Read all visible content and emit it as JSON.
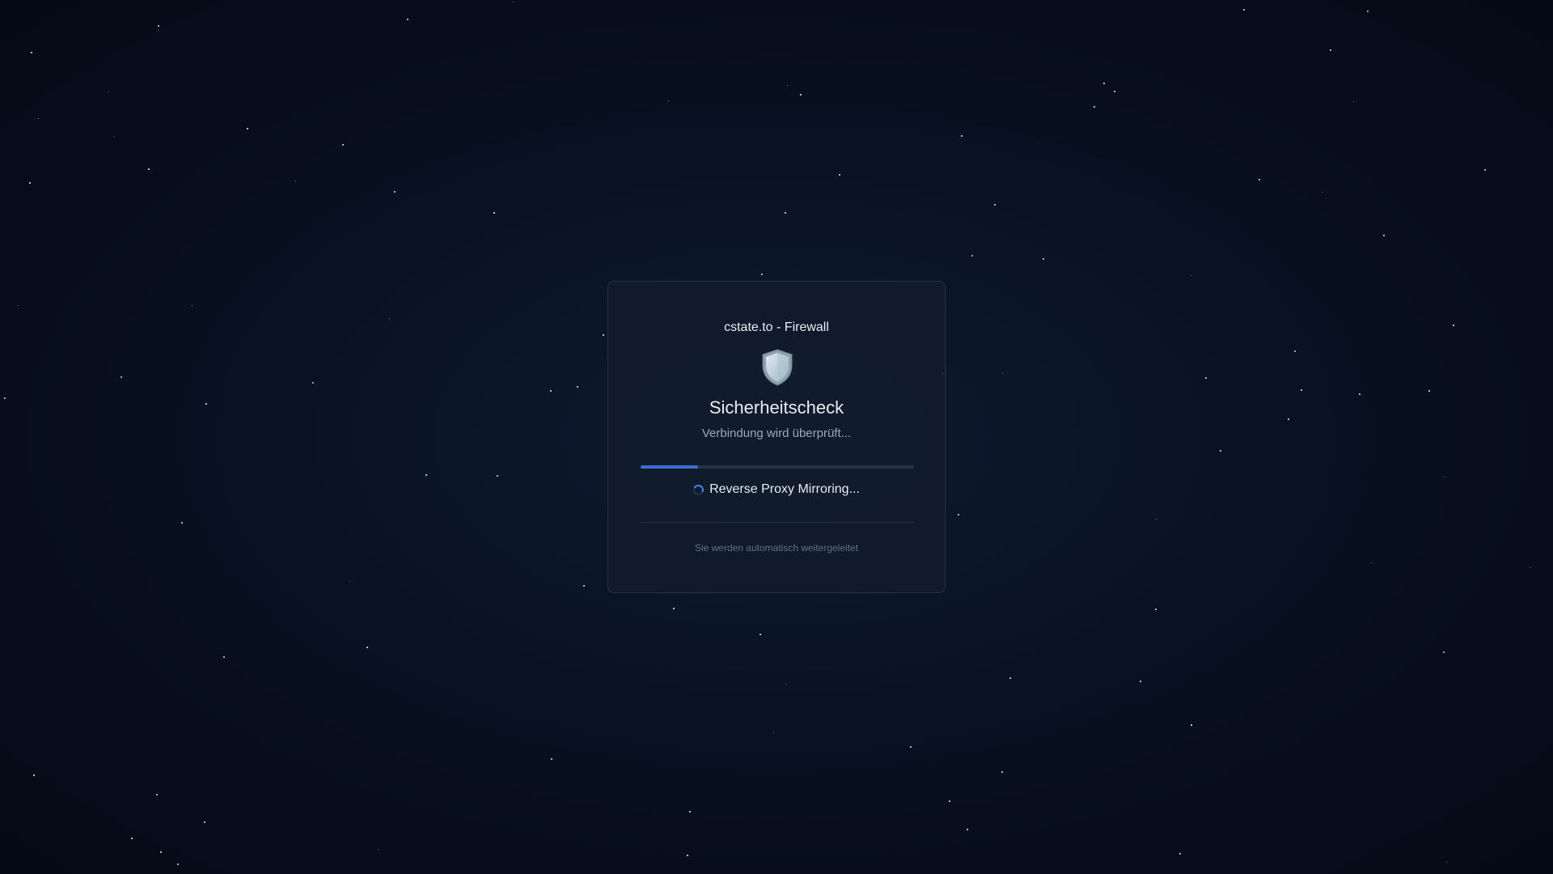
{
  "card": {
    "site_title": "cstate.to - Firewall",
    "shield_icon": "shield-icon",
    "heading": "Sicherheitscheck",
    "subtitle": "Verbindung wird überprüft...",
    "progress_fraction": 0.21,
    "status_icon": "spinner-icon",
    "status_text": "Reverse Proxy Mirroring...",
    "footer_note": "Sie werden automatisch weitergeleitet"
  },
  "colors": {
    "background": "#070d1c",
    "card_background": "#111b2c",
    "accent": "#3b6fd8",
    "text_primary": "#e8ecf2",
    "text_secondary": "#9aa8ba",
    "text_muted": "#627086"
  }
}
